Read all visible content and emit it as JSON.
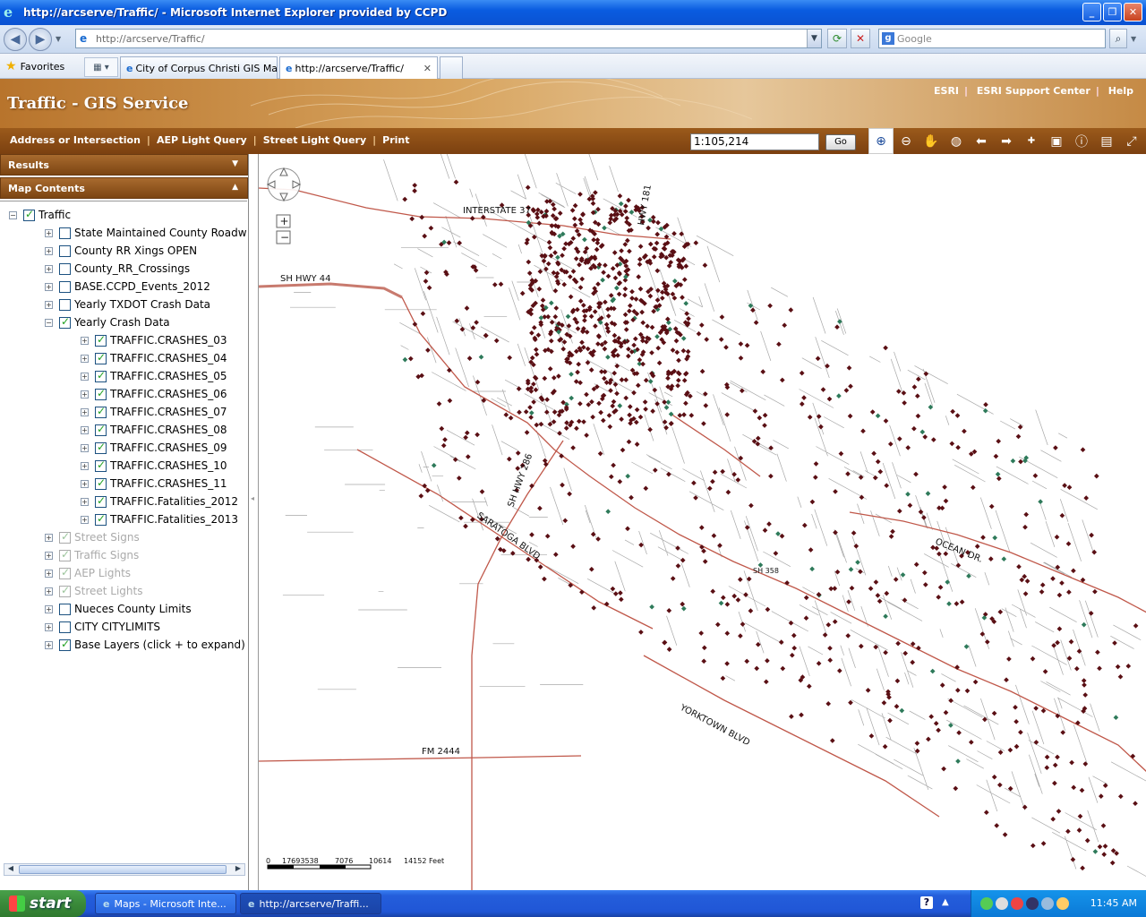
{
  "window": {
    "title": "http://arcserve/Traffic/ - Microsoft Internet Explorer provided by CCPD"
  },
  "address_bar": {
    "url": "http://arcserve/Traffic/",
    "search_placeholder": "Google"
  },
  "favorites_bar": {
    "favorites_label": "Favorites",
    "tabs": [
      {
        "label": "City of Corpus Christi GIS Ma...",
        "active": false
      },
      {
        "label": "http://arcserve/Traffic/",
        "active": true
      }
    ]
  },
  "app_header": {
    "title": "Traffic - GIS Service",
    "links": [
      "ESRI",
      "ESRI Support Center",
      "Help"
    ]
  },
  "toolbar": {
    "menu": [
      "Address or Intersection",
      "AEP Light Query",
      "Street Light Query",
      "Print"
    ],
    "scale_value": "1:105,214",
    "go_label": "Go",
    "tools": [
      "zoom-in-icon",
      "zoom-out-icon",
      "pan-icon",
      "full-extent-icon",
      "back-icon",
      "forward-icon",
      "xy-icon",
      "clear-icon",
      "identify-icon",
      "measure-icon",
      "overview-icon"
    ]
  },
  "left_panel": {
    "results_label": "Results",
    "map_contents_label": "Map Contents",
    "tree": [
      {
        "label": "Traffic",
        "level": 0,
        "checked": true,
        "expanded": true,
        "dim": false
      },
      {
        "label": "State Maintained County Roadways",
        "level": 1,
        "checked": false,
        "expanded": false,
        "dim": false
      },
      {
        "label": "County RR Xings OPEN",
        "level": 1,
        "checked": false,
        "expanded": false,
        "dim": false
      },
      {
        "label": "County_RR_Crossings",
        "level": 1,
        "checked": false,
        "expanded": false,
        "dim": false
      },
      {
        "label": "BASE.CCPD_Events_2012",
        "level": 1,
        "checked": false,
        "expanded": false,
        "dim": false
      },
      {
        "label": "Yearly TXDOT Crash Data",
        "level": 1,
        "checked": false,
        "expanded": false,
        "dim": false
      },
      {
        "label": "Yearly Crash Data",
        "level": 1,
        "checked": true,
        "expanded": true,
        "dim": false
      },
      {
        "label": "TRAFFIC.CRASHES_03",
        "level": 2,
        "checked": true,
        "expanded": false,
        "dim": false
      },
      {
        "label": "TRAFFIC.CRASHES_04",
        "level": 2,
        "checked": true,
        "expanded": false,
        "dim": false
      },
      {
        "label": "TRAFFIC.CRASHES_05",
        "level": 2,
        "checked": true,
        "expanded": false,
        "dim": false
      },
      {
        "label": "TRAFFIC.CRASHES_06",
        "level": 2,
        "checked": true,
        "expanded": false,
        "dim": false
      },
      {
        "label": "TRAFFIC.CRASHES_07",
        "level": 2,
        "checked": true,
        "expanded": false,
        "dim": false
      },
      {
        "label": "TRAFFIC.CRASHES_08",
        "level": 2,
        "checked": true,
        "expanded": false,
        "dim": false
      },
      {
        "label": "TRAFFIC.CRASHES_09",
        "level": 2,
        "checked": true,
        "expanded": false,
        "dim": false
      },
      {
        "label": "TRAFFIC.CRASHES_10",
        "level": 2,
        "checked": true,
        "expanded": false,
        "dim": false
      },
      {
        "label": "TRAFFIC.CRASHES_11",
        "level": 2,
        "checked": true,
        "expanded": false,
        "dim": false
      },
      {
        "label": "TRAFFIC.Fatalities_2012",
        "level": 2,
        "checked": true,
        "expanded": false,
        "dim": false
      },
      {
        "label": "TRAFFIC.Fatalities_2013",
        "level": 2,
        "checked": true,
        "expanded": false,
        "dim": false
      },
      {
        "label": "Street Signs",
        "level": 1,
        "checked": true,
        "expanded": false,
        "dim": true
      },
      {
        "label": "Traffic Signs",
        "level": 1,
        "checked": true,
        "expanded": false,
        "dim": true
      },
      {
        "label": "AEP Lights",
        "level": 1,
        "checked": true,
        "expanded": false,
        "dim": true
      },
      {
        "label": "Street Lights",
        "level": 1,
        "checked": true,
        "expanded": false,
        "dim": true
      },
      {
        "label": "Nueces County Limits",
        "level": 1,
        "checked": false,
        "expanded": false,
        "dim": false
      },
      {
        "label": "CITY CITYLIMITS",
        "level": 1,
        "checked": false,
        "expanded": false,
        "dim": false
      },
      {
        "label": "Base Layers (click + to expand)",
        "level": 1,
        "checked": true,
        "expanded": false,
        "dim": false
      }
    ]
  },
  "map": {
    "road_labels": [
      "INTERSTATE 37",
      "HWY 181",
      "SH HWY 44",
      "SH HWY 286",
      "SARATOGA BLVD",
      "OCEAN DR.",
      "YORKTOWN BLVD",
      "FM 2444",
      "SH 358"
    ],
    "scalebar": {
      "ticks": [
        "0",
        "17693538",
        "7076",
        "10614",
        "14152 Feet"
      ]
    },
    "colors": {
      "crash": "#5a0f14",
      "fatal": "#2e7a5a",
      "major_road": "#c0584a",
      "street": "#a8a8a8"
    }
  },
  "taskbar": {
    "start_label": "start",
    "tasks": [
      "Maps - Microsoft Inte...",
      "http://arcserve/Traffi..."
    ],
    "clock": "11:45 AM"
  }
}
